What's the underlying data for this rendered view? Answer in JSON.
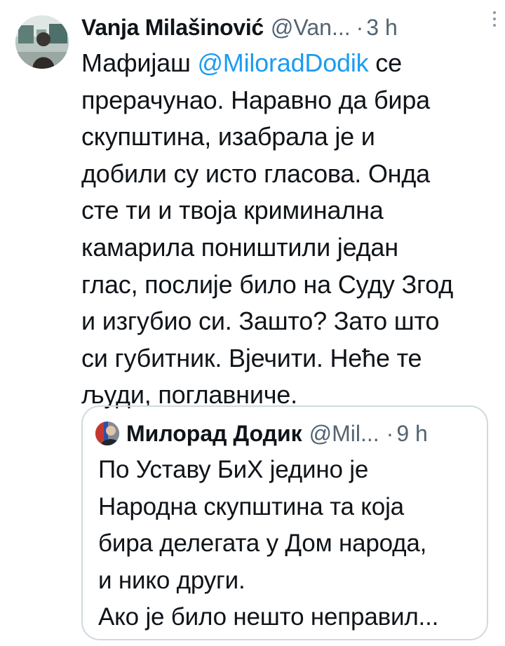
{
  "tweet": {
    "author_name": "Vanja Milašinović",
    "author_handle": "@Van...",
    "separator": "·",
    "time": "3 h",
    "more_icon": "more-vertical-icon",
    "text_before_mention": "Мафијаш ",
    "mention": "@MiloradDodik",
    "text_after_mention": " се",
    "text_lines": [
      "прерачунао. Наравно да бира",
      "скупштина, изабрала је и",
      "добили су исто гласова. Онда",
      "сте ти и твоја криминална",
      "камарила поништили један",
      "глас, послије било на Суду Згод",
      "и изгубио си. Зашто? Зато што",
      "си губитник. Вјечити. Неће те",
      "људи, поглавниче."
    ]
  },
  "quote": {
    "author_name": "Милорад Додик",
    "author_handle": "@Mil...",
    "separator": "·",
    "time": "9 h",
    "text_lines": [
      "По Уставу БиХ једино је",
      "Народна скупштина та која",
      "бира делегата у Дом народа,",
      "и нико други.",
      "Ако је било нешто неправил..."
    ]
  },
  "colors": {
    "link": "#1d9bf0",
    "secondary_text": "#536471",
    "border": "#cfd9de"
  }
}
